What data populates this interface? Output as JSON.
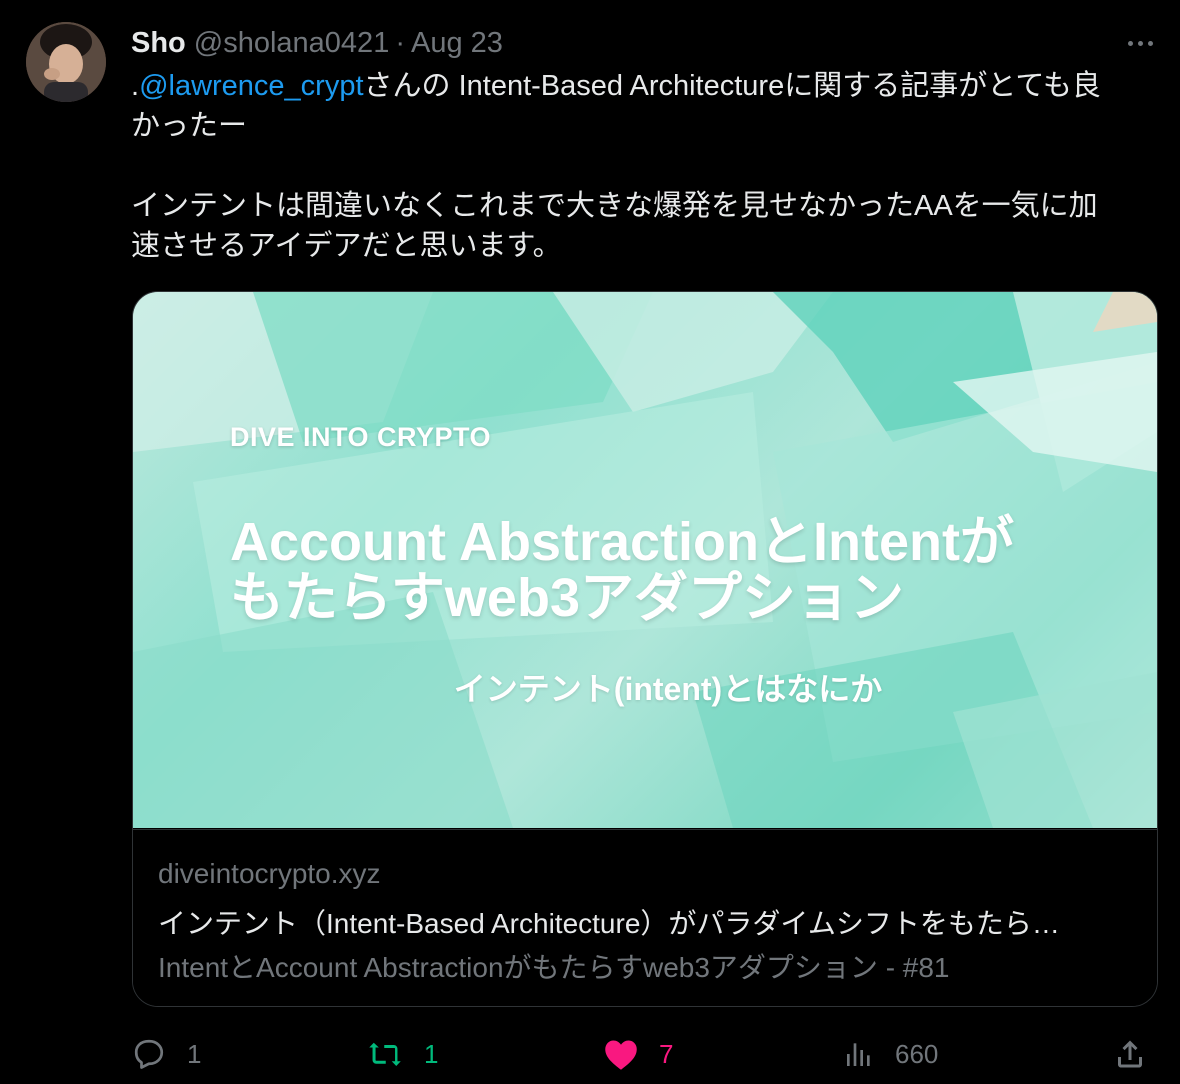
{
  "tweet": {
    "author_name": "Sho",
    "handle": "@sholana0421",
    "separator": "·",
    "date": "Aug 23",
    "text": {
      "line1_prefix": ".",
      "mention": "@lawrence_crypt",
      "line1_rest": "さんの Intent-Based Architectureに関する記事がとても良",
      "line2": "かったー",
      "line3": "インテントは間違いなくこれまで大きな爆発を見せなかったAAを一気に加",
      "line4": "速させるアイデアだと思います。"
    }
  },
  "card": {
    "image": {
      "brand": "DIVE INTO CRYPTO",
      "headline_line1": "Account AbstractionとIntentが",
      "headline_line2": "もたらすweb3アダプション",
      "subtitle": "インテント(intent)とはなにか"
    },
    "domain": "diveintocrypto.xyz",
    "title": "インテント（Intent-Based Architecture）がパラダイムシフトをもたら…",
    "description": "IntentとAccount Abstractionがもたらすweb3アダプション - #81"
  },
  "actions": {
    "reply_count": "1",
    "retweet_count": "1",
    "like_count": "7",
    "views_count": "660"
  },
  "colors": {
    "background": "#000000",
    "text_primary": "#e7e9ea",
    "text_secondary": "#71767b",
    "mention": "#1d9bf0",
    "retweet": "#00ba7c",
    "like": "#f91880",
    "border": "#2f3336"
  },
  "icons": [
    "avatar",
    "more-icon",
    "reply-icon",
    "retweet-icon",
    "heart-icon",
    "views-icon",
    "share-icon"
  ]
}
